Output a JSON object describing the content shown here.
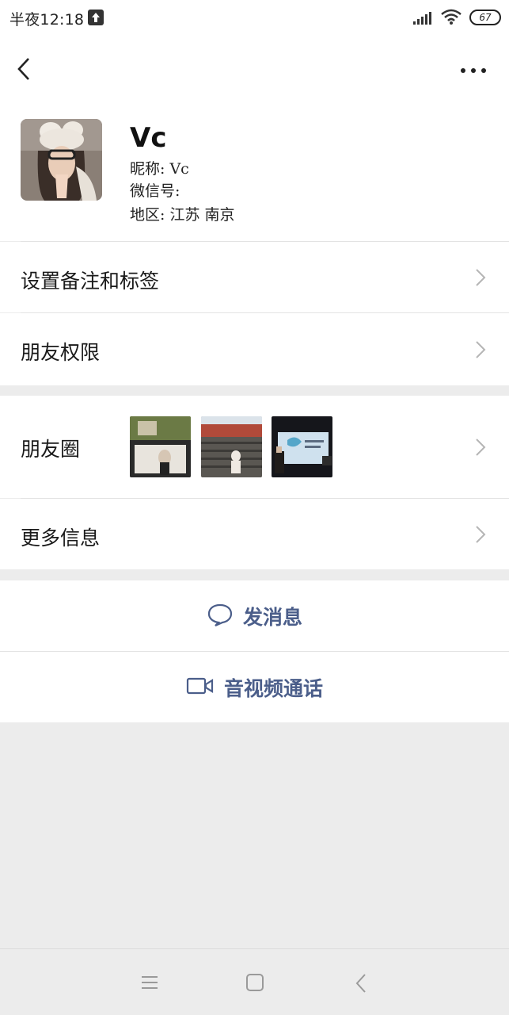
{
  "status_bar": {
    "time": "半夜12:18",
    "battery": "67",
    "icons": [
      "upload-icon",
      "signal-icon",
      "wifi-icon",
      "battery-icon"
    ]
  },
  "navbar": {
    "back_icon": "back-chevron-icon",
    "more_icon": "more-dots-icon"
  },
  "profile": {
    "display_name": "Vc",
    "nickname_line": "昵称: Vc",
    "wechat_id_line": "微信号:",
    "region_line": "地区: 江苏 南京"
  },
  "list": {
    "remark_tags": "设置备注和标签",
    "friend_permissions": "朋友权限",
    "moments": "朋友圈",
    "more_info": "更多信息"
  },
  "actions": {
    "send_message": "发消息",
    "video_call": "音视频通话"
  },
  "colors": {
    "accent_text": "#4b5e8a",
    "background": "#ececec",
    "card": "#ffffff"
  }
}
